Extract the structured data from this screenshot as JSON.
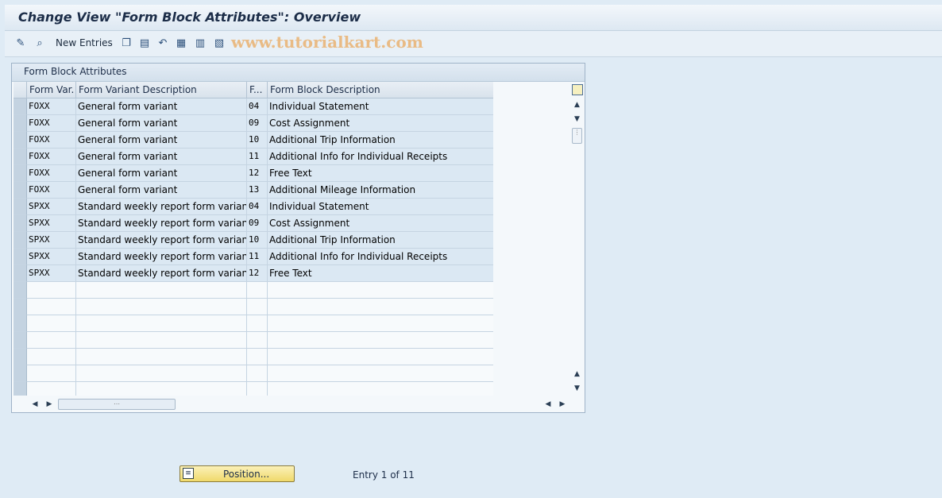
{
  "window": {
    "title": "Change View \"Form Block Attributes\": Overview"
  },
  "toolbar": {
    "new_entries_label": "New Entries",
    "watermark": "www.tutorialkart.com"
  },
  "panel": {
    "title": "Form Block Attributes",
    "columns": [
      "Form Var.",
      "Form Variant Description",
      "F...",
      "Form Block Description"
    ],
    "rows": [
      [
        "FOXX",
        "General form variant",
        "04",
        "Individual Statement"
      ],
      [
        "FOXX",
        "General form variant",
        "09",
        "Cost Assignment"
      ],
      [
        "FOXX",
        "General form variant",
        "10",
        "Additional Trip Information"
      ],
      [
        "FOXX",
        "General form variant",
        "11",
        "Additional Info for Individual Receipts"
      ],
      [
        "FOXX",
        "General form variant",
        "12",
        "Free Text"
      ],
      [
        "FOXX",
        "General form variant",
        "13",
        "Additional Mileage Information"
      ],
      [
        "SPXX",
        "Standard weekly report form variant",
        "04",
        "Individual Statement"
      ],
      [
        "SPXX",
        "Standard weekly report form variant",
        "09",
        "Cost Assignment"
      ],
      [
        "SPXX",
        "Standard weekly report form variant",
        "10",
        "Additional Trip Information"
      ],
      [
        "SPXX",
        "Standard weekly report form variant",
        "11",
        "Additional Info for Individual Receipts"
      ],
      [
        "SPXX",
        "Standard weekly report form variant",
        "12",
        "Free Text"
      ]
    ],
    "empty_rows": 7
  },
  "footer": {
    "position_label": "Position...",
    "entry_info": "Entry 1 of 11"
  },
  "colors": {
    "accent": "#f0d96b",
    "row_fill": "#dbe8f3",
    "background": "#dfebf5"
  }
}
